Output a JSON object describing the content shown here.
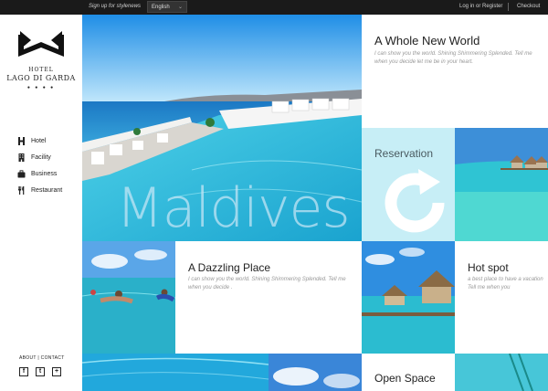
{
  "topbar": {
    "signup": "Sign up for stylenews",
    "language": "English",
    "login": "Log in or Register",
    "checkout": "Checkout"
  },
  "brand": {
    "line1": "HOTEL",
    "line2": "LAGO DI GARDA",
    "dots": "● ● ● ●"
  },
  "nav": {
    "items": [
      {
        "label": "Hotel",
        "icon": "h-letter-icon"
      },
      {
        "label": "Facility",
        "icon": "building-icon"
      },
      {
        "label": "Business",
        "icon": "briefcase-icon"
      },
      {
        "label": "Restaurant",
        "icon": "cutlery-icon"
      }
    ]
  },
  "footer": {
    "about": "ABOUT",
    "divider": "|",
    "contact": "CONTACT",
    "social": [
      "f",
      "t",
      "+"
    ]
  },
  "hero": {
    "word": "Maldives"
  },
  "tiles": {
    "whole": {
      "title": "A Whole New World",
      "text": "I can show you the world. Shining Shimmering Splended. Tell me when you decide let me be in your heart."
    },
    "reservation": {
      "title": "Reservation",
      "icon": "refresh-icon"
    },
    "dazzling": {
      "title": "A Dazzling Place",
      "text": "I can show you the world. Shining Shimmering Splended. Tell me when you decide ."
    },
    "hotspot": {
      "title": "Hot spot",
      "text": "a best place to have a vacation Tell me when you"
    },
    "openspace": {
      "title": "Open Space"
    }
  },
  "colors": {
    "topbar": "#1a1a1a",
    "reservation_bg": "#c7eef6",
    "water": "#2bb8d6",
    "sky": "#4aa3e6"
  }
}
